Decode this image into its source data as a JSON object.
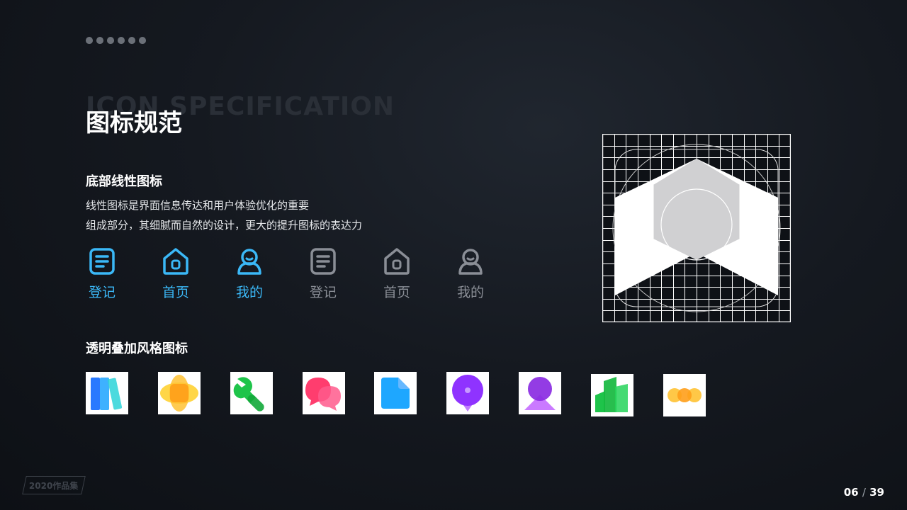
{
  "header": {
    "bg_title": "ICON SPECIFICATION",
    "title": "图标规范"
  },
  "section1": {
    "heading": "底部线性图标",
    "desc_line1": "线性图标是界面信息传达和用户体验优化的重要",
    "desc_line2": "组成部分，其细腻而自然的设计，更大的提升图标的表达力"
  },
  "line_icons": [
    {
      "label": "登记",
      "icon": "document-icon",
      "color": "#3bb8f7"
    },
    {
      "label": "首页",
      "icon": "home-icon",
      "color": "#3bb8f7"
    },
    {
      "label": "我的",
      "icon": "user-icon",
      "color": "#3bb8f7"
    },
    {
      "label": "登记",
      "icon": "document-icon",
      "color": "#8a8e96"
    },
    {
      "label": "首页",
      "icon": "home-icon",
      "color": "#8a8e96"
    },
    {
      "label": "我的",
      "icon": "user-icon",
      "color": "#8a8e96"
    }
  ],
  "section2": {
    "heading": "透明叠加风格图标"
  },
  "app_icons": [
    {
      "icon": "books-icon"
    },
    {
      "icon": "orange-blob-icon"
    },
    {
      "icon": "wrench-icon"
    },
    {
      "icon": "chat-bubbles-icon"
    },
    {
      "icon": "file-icon"
    },
    {
      "icon": "location-pin-icon"
    },
    {
      "icon": "person-icon"
    },
    {
      "icon": "building-chart-icon"
    },
    {
      "icon": "coins-icon"
    }
  ],
  "footer": {
    "badge": "2020作品集",
    "page_current": "06",
    "page_separator": "/",
    "page_total": "39"
  },
  "colors": {
    "accent_blue": "#3bb8f7",
    "inactive_gray": "#8a8e96",
    "background": "#151920"
  }
}
